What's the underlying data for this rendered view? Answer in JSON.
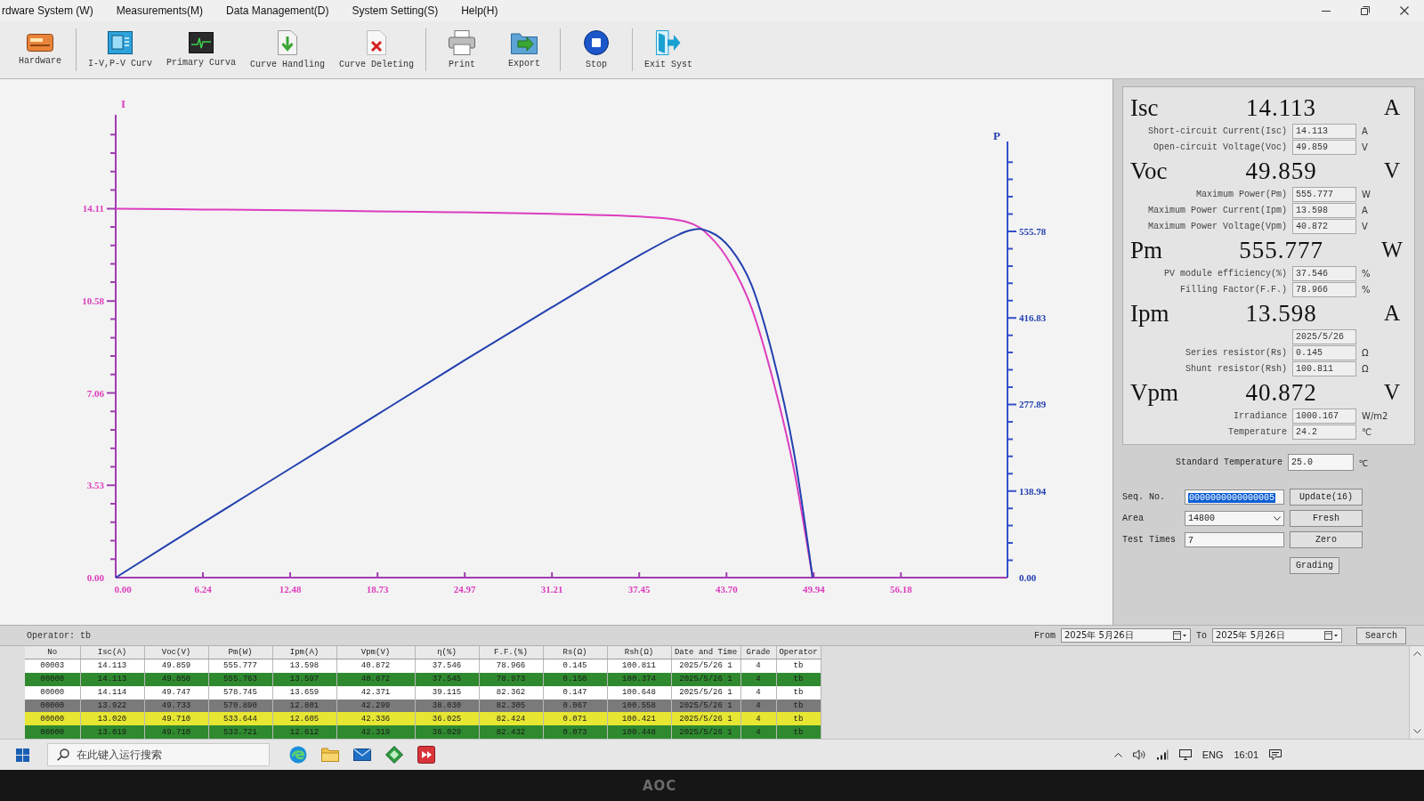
{
  "menu_bar": {
    "items": [
      "rdware System (W)",
      "Measurements(M)",
      "Data Management(D)",
      "System Setting(S)",
      "Help(H)"
    ]
  },
  "toolbar": {
    "buttons": [
      {
        "label": "Hardware",
        "kind": "hardware",
        "separator_after": true
      },
      {
        "label": "I-V,P-V Curv",
        "kind": "curves",
        "separator_after": false
      },
      {
        "label": "Primary Curva",
        "kind": "primary",
        "separator_after": false
      },
      {
        "label": "Curve Handling",
        "kind": "handling",
        "separator_after": false
      },
      {
        "label": "Curve Deleting",
        "kind": "deleting",
        "separator_after": true
      },
      {
        "label": "Print",
        "kind": "print",
        "separator_after": false
      },
      {
        "label": "Export",
        "kind": "export",
        "separator_after": true
      },
      {
        "label": "Stop",
        "kind": "stop",
        "separator_after": true
      },
      {
        "label": "Exit Syst",
        "kind": "exit",
        "separator_after": false
      }
    ]
  },
  "chart": {
    "chart_data": {
      "type": "line",
      "x": [
        0,
        6.24,
        12.48,
        18.73,
        24.97,
        31.21,
        37.45,
        40.87,
        42.5,
        44.0,
        45.5,
        47.0,
        48.5,
        49.86
      ],
      "xlim": [
        0,
        63.8
      ],
      "ylim": [
        0,
        17.7
      ],
      "xticks": [
        {
          "value": 0,
          "label": "0.00"
        },
        {
          "value": 6.24,
          "label": "6.24"
        },
        {
          "value": 12.48,
          "label": "12.48"
        },
        {
          "value": 18.73,
          "label": "18.73"
        },
        {
          "value": 24.97,
          "label": "24.97"
        },
        {
          "value": 31.21,
          "label": "31.21"
        },
        {
          "value": 37.45,
          "label": "37.45"
        },
        {
          "value": 43.7,
          "label": "43.70"
        },
        {
          "value": 49.94,
          "label": "49.94"
        },
        {
          "value": 56.18,
          "label": "56.18"
        }
      ],
      "yticks": [
        {
          "value": 0,
          "label": "0.00"
        },
        {
          "value": 3.53,
          "label": "3.53"
        },
        {
          "value": 7.06,
          "label": "7.06"
        },
        {
          "value": 10.58,
          "label": "10.58"
        },
        {
          "value": 14.11,
          "label": "14.11"
        }
      ],
      "series": [
        {
          "name": "I",
          "color": "#dd3dbd",
          "values": [
            14.11,
            14.08,
            14.05,
            14.01,
            13.97,
            13.91,
            13.81,
            13.6,
            13.05,
            12.0,
            10.3,
            7.6,
            4.2,
            0
          ]
        }
      ]
    }
  },
  "power_chart": {
    "chart_data": {
      "type": "line",
      "x": [
        0,
        6.24,
        12.48,
        18.73,
        24.97,
        31.21,
        37.45,
        40.87,
        42.5,
        44.0,
        45.5,
        47.0,
        48.5,
        49.86
      ],
      "xlim": [
        0,
        63.8
      ],
      "ylim": [
        0,
        700
      ],
      "yticks": [
        {
          "value": 0,
          "label": "0.00"
        },
        {
          "value": 138.94,
          "label": "138.94"
        },
        {
          "value": 277.89,
          "label": "277.89"
        },
        {
          "value": 416.83,
          "label": "416.83"
        },
        {
          "value": 555.78,
          "label": "555.78"
        }
      ],
      "series": [
        {
          "name": "P",
          "color": "#2340b0",
          "values": [
            0,
            88,
            175,
            262,
            349,
            434,
            517,
            556,
            555,
            528,
            469,
            357,
            204,
            0
          ]
        }
      ]
    }
  },
  "panel": {
    "measurements": [
      {
        "kind": "headline",
        "label": "Isc",
        "value": "14.113",
        "unit": "A"
      },
      {
        "kind": "field",
        "label": "Short-circuit Current(Isc)",
        "value": "14.113",
        "unit": "A"
      },
      {
        "kind": "field",
        "label": "Open-circuit Voltage(Voc)",
        "value": "49.859",
        "unit": "V"
      },
      {
        "kind": "headline",
        "label": "Voc",
        "value": "49.859",
        "unit": "V"
      },
      {
        "kind": "field",
        "label": "Maximum Power(Pm)",
        "value": "555.777",
        "unit": "W"
      },
      {
        "kind": "field",
        "label": "Maximum Power Current(Ipm)",
        "value": "13.598",
        "unit": "A"
      },
      {
        "kind": "field",
        "label": "Maximum Power Voltage(Vpm)",
        "value": "40.872",
        "unit": "V"
      },
      {
        "kind": "headline",
        "label": "Pm",
        "value": "555.777",
        "unit": "W"
      },
      {
        "kind": "field",
        "label": "PV module efficiency(%)",
        "value": "37.546",
        "unit": "%"
      },
      {
        "kind": "field",
        "label": "Filling Factor(F.F.)",
        "value": "78.966",
        "unit": "%"
      },
      {
        "kind": "headline",
        "label": "Ipm",
        "value": "13.598",
        "unit": "A"
      },
      {
        "kind": "field",
        "value": "2025/5/26"
      },
      {
        "kind": "field",
        "label": "Series resistor(Rs)",
        "value": "0.145",
        "unit": "Ω"
      },
      {
        "kind": "field",
        "label": "Shunt resistor(Rsh)",
        "value": "100.811",
        "unit": "Ω"
      },
      {
        "kind": "headline",
        "label": "Vpm",
        "value": "40.872",
        "unit": "V"
      },
      {
        "kind": "field",
        "label": "Irradiance",
        "value": "1000.167",
        "unit": "W/m2"
      },
      {
        "kind": "field",
        "label": "Temperature",
        "value": "24.2",
        "unit": "℃"
      }
    ],
    "standard_temperature": {
      "label": "Standard Temperature",
      "value": "25.0",
      "unit": "℃"
    },
    "seq_no": {
      "label": "Seq. No.",
      "value": "0000000000000005",
      "text_selected": true
    },
    "update_button": "Update(16)",
    "area": {
      "label": "Area",
      "value": "14800"
    },
    "fresh_button": "Fresh",
    "test_times": {
      "label": "Test Times",
      "value": "7"
    },
    "zero_button": "Zero",
    "grading_button": "Grading"
  },
  "filter_bar": {
    "operator": "Operator: tb",
    "from": {
      "label": "From",
      "value": "2025年 5月26日"
    },
    "to": {
      "label": "To",
      "value": "2025年 5月26日"
    },
    "search_button": "Search"
  },
  "table": {
    "columns": [
      "No",
      "Isc(A)",
      "Voc(V)",
      "Pm(W)",
      "Ipm(A)",
      "Vpm(V)",
      "η(%)",
      "F.F.(%)",
      "Rs(Ω)",
      "Rsh(Ω)",
      "Date and Time",
      "Grade",
      "Operator"
    ],
    "rows": [
      {
        "color": "#ffffff",
        "cells": [
          "00003",
          "14.113",
          "49.859",
          "555.777",
          "13.598",
          "40.872",
          "37.546",
          "78.966",
          "0.145",
          "100.811",
          "2025/5/26 1",
          "4",
          "tb"
        ]
      },
      {
        "color": "#2f8a2f",
        "cells": [
          "00000",
          "14.113",
          "49.850",
          "555.763",
          "13.597",
          "40.872",
          "37.545",
          "78.973",
          "0.150",
          "100.374",
          "2025/5/26 1",
          "4",
          "tb"
        ]
      },
      {
        "color": "#ffffff",
        "cells": [
          "00000",
          "14.114",
          "49.747",
          "578.745",
          "13.659",
          "42.371",
          "39.115",
          "82.362",
          "0.147",
          "100.648",
          "2025/5/26 1",
          "4",
          "tb"
        ]
      },
      {
        "color": "#7a7a7a",
        "cells": [
          "00000",
          "13.922",
          "49.733",
          "570.890",
          "12.801",
          "42.299",
          "38.030",
          "82.305",
          "0.067",
          "100.558",
          "2025/5/26 1",
          "4",
          "tb"
        ]
      },
      {
        "color": "#e6e633",
        "cells": [
          "00000",
          "13.020",
          "49.710",
          "533.644",
          "12.605",
          "42.336",
          "36.025",
          "82.424",
          "0.071",
          "100.421",
          "2025/5/26 1",
          "4",
          "tb"
        ]
      },
      {
        "color": "#2f8a2f",
        "cells": [
          "00000",
          "13.019",
          "49.710",
          "533.721",
          "12.612",
          "42.319",
          "36.029",
          "82.432",
          "0.073",
          "100.448",
          "2025/5/26 1",
          "4",
          "tb"
        ]
      }
    ]
  },
  "taskbar": {
    "search": {
      "placeholder": "在此键入运行搜索"
    },
    "language": "ENG",
    "time": "16:01"
  },
  "bezel": {
    "brand": "AOC"
  }
}
